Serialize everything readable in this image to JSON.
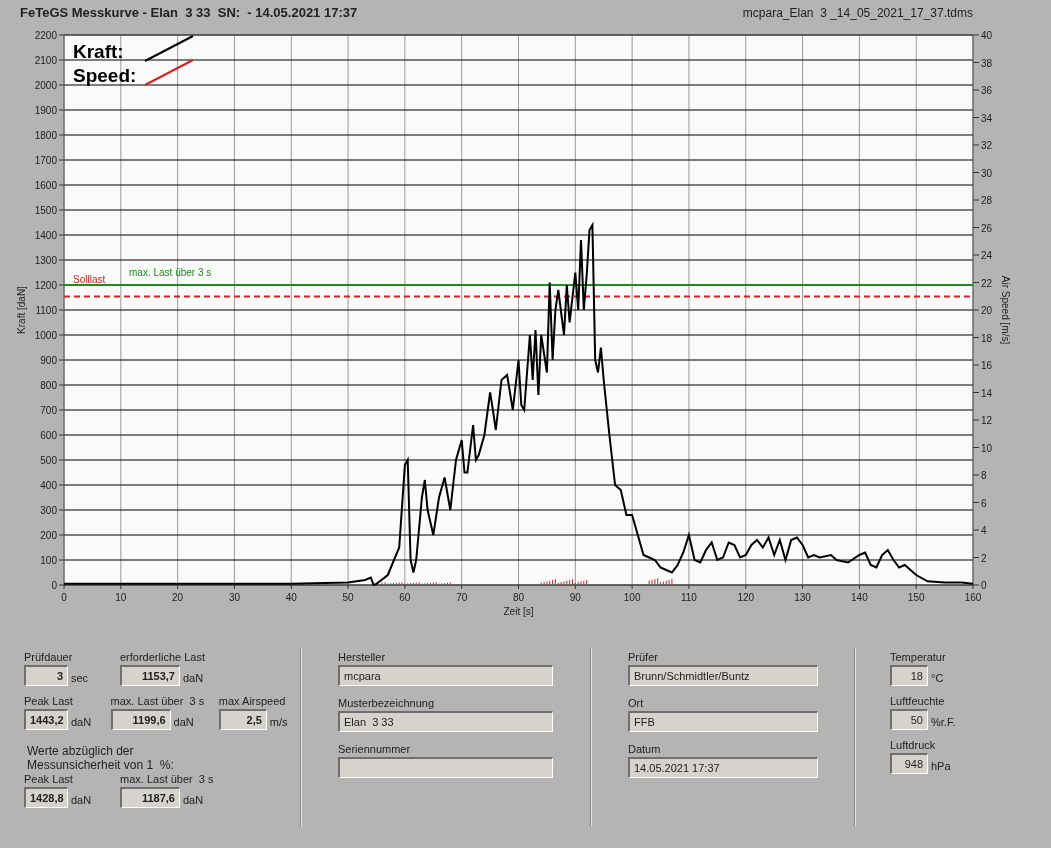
{
  "header": {
    "title": "FeTeGS Messkurve - Elan  3 33  SN:  - 14.05.2021 17:37",
    "file": "mcpara_Elan  3 _14_05_2021_17_37.tdms"
  },
  "chart": {
    "speed_legend": {
      "label": "Speed:",
      "color": "#d42020"
    },
    "y2label": "Air Speed [m/s]",
    "y2_tick_labels": [
      "40",
      "38",
      "36",
      "34",
      "32",
      "30",
      "28",
      "26",
      "24",
      "22",
      "20",
      "18",
      "16",
      "14",
      "12",
      "10",
      "8",
      "6",
      "4",
      "2",
      "0"
    ],
    "chart_data": {
      "type": "line",
      "grid": true,
      "xlabel": "Zeit [s]",
      "ylabel": "Kraft [daN]",
      "xlim": [
        0,
        160
      ],
      "ylim": [
        0,
        2200
      ],
      "xticks": [
        0,
        10,
        20,
        30,
        40,
        50,
        60,
        70,
        80,
        90,
        100,
        110,
        120,
        130,
        140,
        150,
        160
      ],
      "yticks": [
        0,
        100,
        200,
        300,
        400,
        500,
        600,
        700,
        800,
        900,
        1000,
        1100,
        1200,
        1300,
        1400,
        1500,
        1600,
        1700,
        1800,
        1900,
        2000,
        2100,
        2200
      ],
      "x": [
        0,
        10,
        20,
        30,
        40,
        50,
        53,
        54,
        54.5,
        55,
        57,
        59,
        60,
        60.5,
        61,
        61.5,
        62,
        63,
        63.5,
        64,
        65,
        66,
        67,
        68,
        69,
        70,
        70.5,
        71,
        72,
        72.5,
        73,
        74,
        75,
        75.5,
        76,
        77,
        78,
        79,
        80,
        80.5,
        81,
        82,
        82.5,
        83,
        83.5,
        84,
        85,
        85.5,
        86,
        86.5,
        87,
        88,
        88.5,
        89,
        90,
        90.5,
        91,
        91.5,
        92,
        92.5,
        93,
        93.5,
        94,
        94.5,
        95,
        96,
        97,
        98,
        99,
        100,
        101,
        102,
        103,
        104,
        105,
        106,
        107,
        108,
        109,
        110,
        111,
        112,
        113,
        114,
        115,
        116,
        117,
        118,
        119,
        120,
        121,
        122,
        123,
        124,
        125,
        126,
        127,
        128,
        129,
        130,
        131,
        132,
        133,
        135,
        136,
        138,
        140,
        141,
        142,
        143,
        144,
        145,
        146,
        147,
        148,
        149,
        150,
        152,
        155,
        158,
        160
      ],
      "series": [
        {
          "name": "Kraft:",
          "color": "#000000",
          "values": [
            5,
            5,
            5,
            5,
            5,
            10,
            20,
            30,
            0,
            5,
            40,
            150,
            480,
            500,
            100,
            50,
            100,
            350,
            420,
            300,
            200,
            350,
            430,
            300,
            500,
            580,
            450,
            450,
            640,
            500,
            520,
            600,
            770,
            700,
            620,
            820,
            840,
            700,
            900,
            720,
            700,
            1000,
            820,
            1020,
            760,
            1000,
            850,
            1210,
            900,
            1100,
            1180,
            1000,
            1200,
            1050,
            1250,
            1100,
            1380,
            1100,
            1240,
            1420,
            1440,
            900,
            850,
            950,
            820,
            600,
            400,
            380,
            280,
            280,
            200,
            120,
            110,
            100,
            70,
            60,
            50,
            80,
            130,
            200,
            100,
            90,
            140,
            170,
            100,
            110,
            170,
            160,
            110,
            120,
            160,
            180,
            150,
            190,
            120,
            180,
            100,
            180,
            190,
            160,
            110,
            120,
            110,
            120,
            100,
            90,
            120,
            130,
            80,
            70,
            120,
            140,
            100,
            70,
            80,
            60,
            40,
            15,
            10,
            10,
            5
          ]
        }
      ],
      "ref_lines": [
        {
          "axis": "y",
          "value": 1200,
          "label": "max. Last über  3 s",
          "color": "#1e8c1e"
        },
        {
          "axis": "y",
          "value": 1153.7,
          "label": "Solllast",
          "color": "#d42020"
        }
      ]
    }
  },
  "results": {
    "rows": [
      [
        {
          "label": "Prüfdauer",
          "value": "3",
          "unit": "sec"
        },
        {
          "label": "erforderliche Last",
          "value": "1153,7",
          "unit": "daN"
        }
      ],
      [
        {
          "label": "Peak Last",
          "value": "1443,2",
          "unit": "daN"
        },
        {
          "label": "max. Last über  3 s",
          "value": "1199,6",
          "unit": "daN"
        },
        {
          "label": "max Airspeed",
          "value": "2,5",
          "unit": "m/s"
        }
      ]
    ],
    "note": "Werte abzüglich der Messunsicherheit von 1  %:",
    "corrected": [
      {
        "label": "Peak Last",
        "value": "1428,8",
        "unit": "daN"
      },
      {
        "label": "max. Last über  3 s",
        "value": "1187,6",
        "unit": "daN"
      }
    ]
  },
  "info": [
    {
      "label": "Hersteller",
      "value": "mcpara"
    },
    {
      "label": "Musterbezeichnung",
      "value": "Elan  3 33"
    },
    {
      "label": "Seriennummer"
    }
  ],
  "test": [
    {
      "label": "Prüfer",
      "value": "Brunn/Schmidtler/Buntz"
    },
    {
      "label": "Ort",
      "value": "FFB"
    },
    {
      "label": "Datum",
      "value": "14.05.2021 17:37"
    }
  ],
  "conditions": [
    {
      "label": "Temperatur",
      "value": "18",
      "unit": "°C"
    },
    {
      "label": "Luftfeuchte",
      "value": "50",
      "unit": "%r.F."
    },
    {
      "label": "Luftdruck",
      "value": "948",
      "unit": "hPa"
    }
  ]
}
